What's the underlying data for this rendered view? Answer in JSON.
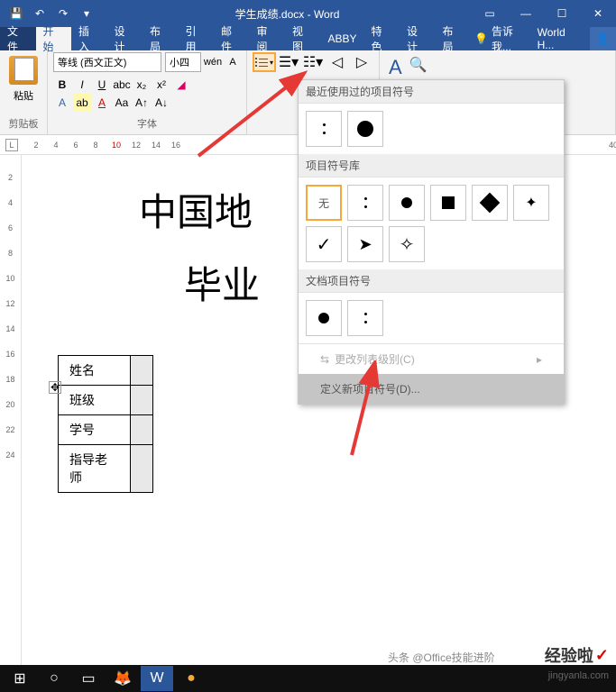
{
  "titlebar": {
    "title": "学生成绩.docx - Word"
  },
  "tabs": {
    "file": "文件",
    "home": "开始",
    "insert": "插入",
    "design": "设计",
    "layout": "布局",
    "references": "引用",
    "mailings": "邮件",
    "review": "审阅",
    "view": "视图",
    "abbyy": "ABBY",
    "special": "特色",
    "design2": "设计",
    "layout2": "布局",
    "tellme": "告诉我...",
    "share": "World H..."
  },
  "ribbon": {
    "clipboard": {
      "label": "剪贴板",
      "paste": "粘贴"
    },
    "font": {
      "label": "字体",
      "name": "等线 (西文正文)",
      "size": "小四"
    }
  },
  "ruler": {
    "corner": "L",
    "h": [
      "2",
      "4",
      "6",
      "8",
      "10",
      "12",
      "14",
      "16",
      "",
      "",
      "",
      "",
      "",
      "",
      "",
      "",
      "",
      "",
      "",
      "40"
    ],
    "v": [
      "",
      "",
      "2",
      "",
      "4",
      "",
      "6",
      "",
      "8",
      "",
      "10",
      "",
      "12",
      "",
      "14",
      "",
      "16",
      "",
      "18",
      "",
      "20",
      "",
      "22",
      "",
      "24"
    ]
  },
  "document": {
    "line1": "中国地",
    "line2": "毕业",
    "table": {
      "r1": "姓名",
      "r2": "班级",
      "r3": "学号",
      "r4": "指导老师"
    }
  },
  "bullet_menu": {
    "recent": "最近使用过的项目符号",
    "library": "项目符号库",
    "none": "无",
    "doc_bullets": "文档项目符号",
    "change_level": "更改列表级别(C)",
    "define_new": "定义新项目符号(D)..."
  },
  "watermark": {
    "main": "经验啦",
    "sub": "jingyanla.com",
    "toutiao": "头条 @Office技能进阶"
  }
}
